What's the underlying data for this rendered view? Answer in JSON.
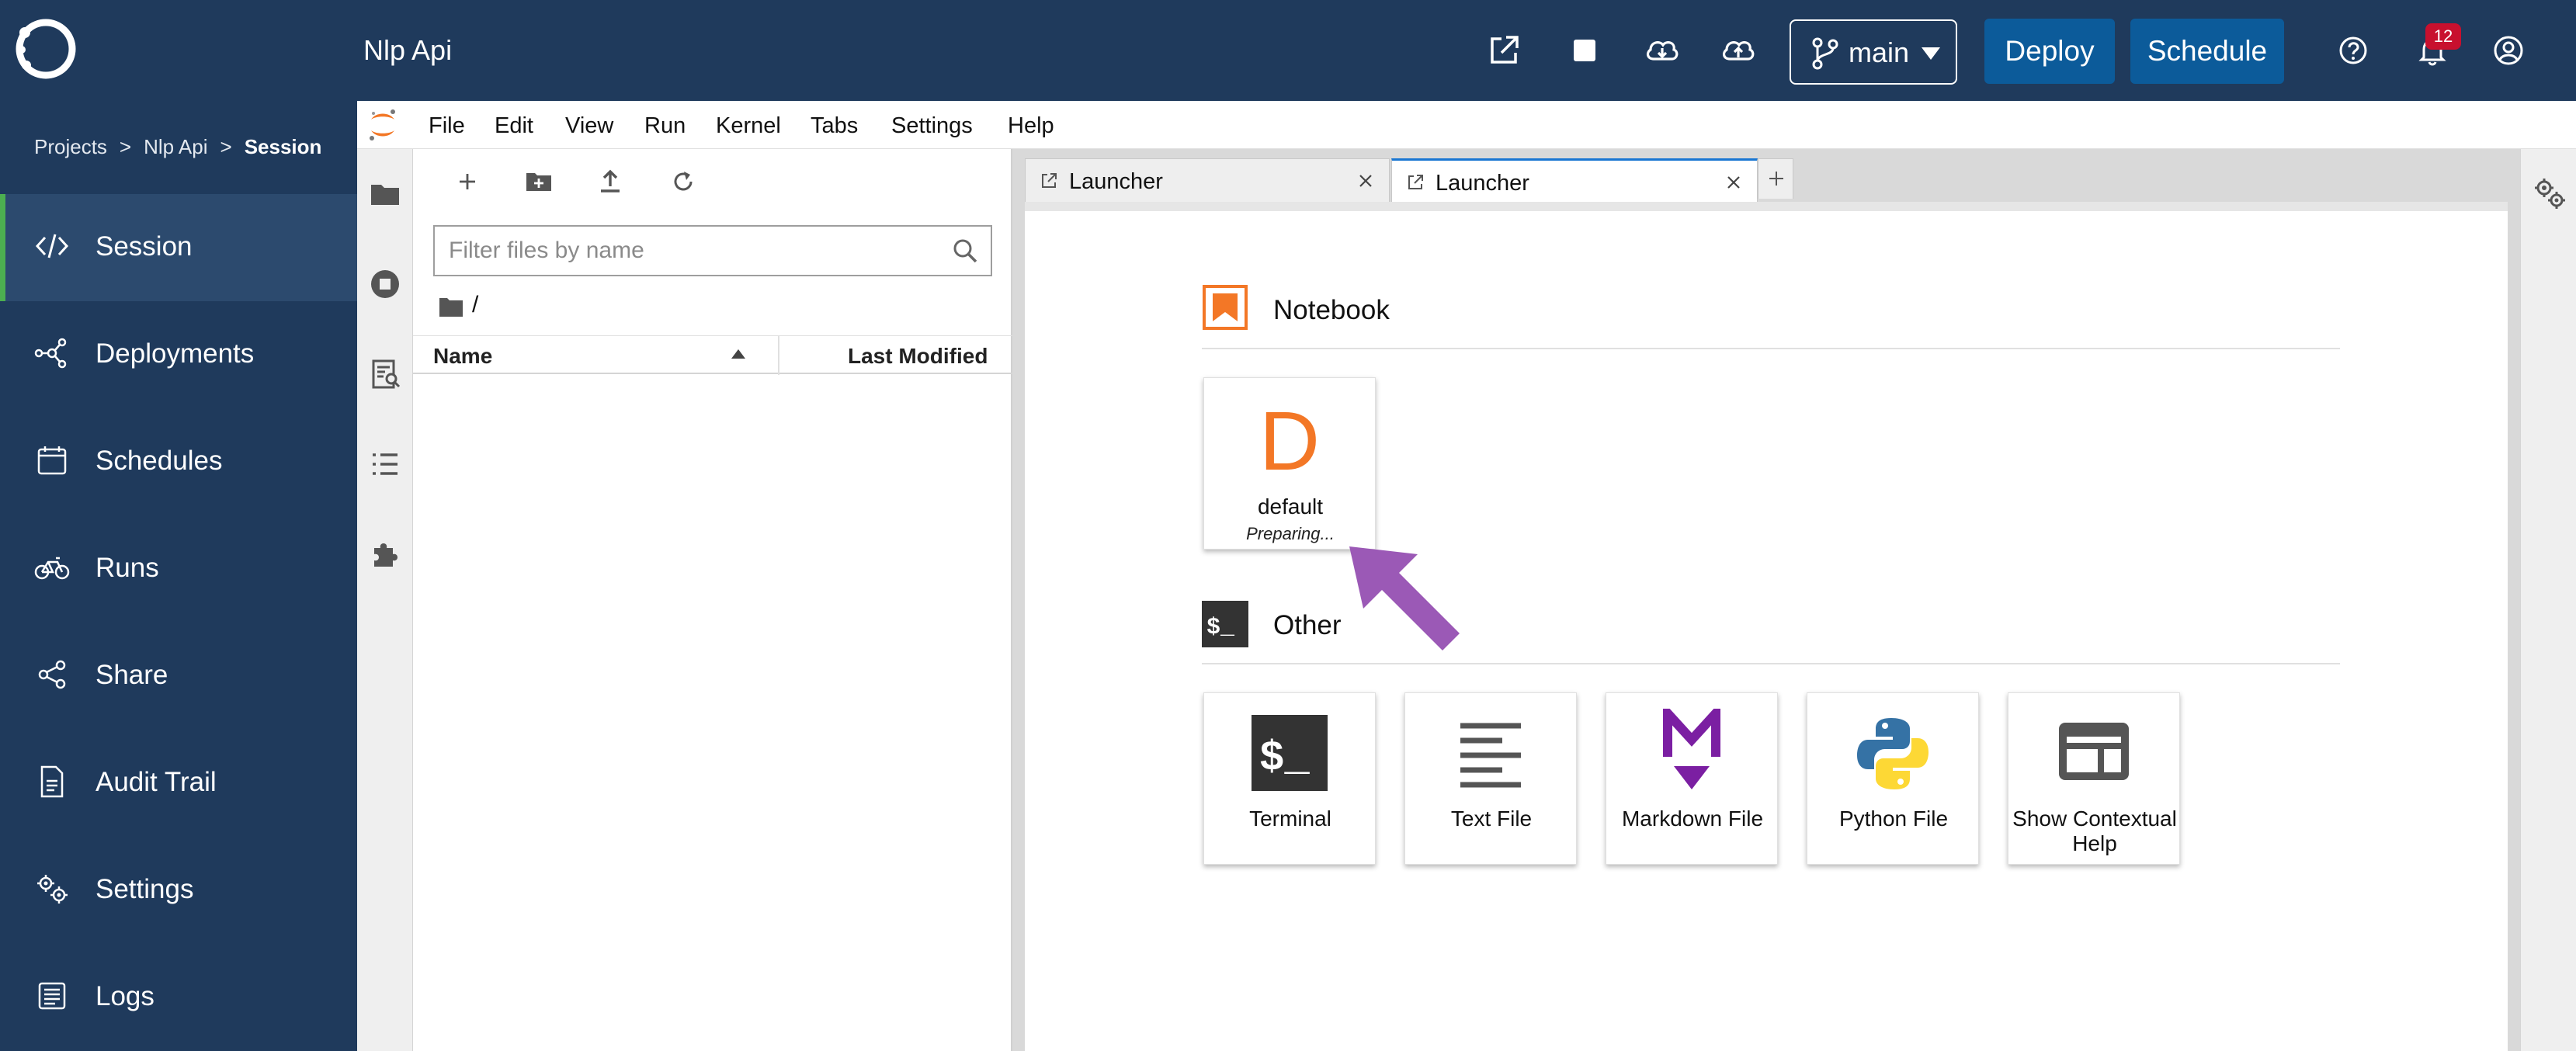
{
  "app": {
    "project_title": "Nlp Api",
    "notification_count": "12",
    "branch": "main",
    "deploy_label": "Deploy",
    "schedule_label": "Schedule"
  },
  "colors": {
    "nav_bg": "#1f3a5c",
    "nav_active_bg": "#2c4a6e",
    "active_indicator": "#4caf50",
    "primary_button": "#0c5b9a",
    "badge": "#c8102e",
    "jupyter_orange": "#f37726",
    "annotation_arrow": "#9b59b6"
  },
  "breadcrumb": {
    "items": [
      "Projects",
      "Nlp Api",
      "Session"
    ],
    "separator": ">"
  },
  "nav": {
    "items": [
      {
        "label": "Session",
        "icon": "code-icon",
        "active": true
      },
      {
        "label": "Deployments",
        "icon": "network-icon",
        "active": false
      },
      {
        "label": "Schedules",
        "icon": "calendar-icon",
        "active": false
      },
      {
        "label": "Runs",
        "icon": "bicycle-icon",
        "active": false
      },
      {
        "label": "Share",
        "icon": "share-icon",
        "active": false
      },
      {
        "label": "Audit Trail",
        "icon": "document-icon",
        "active": false
      },
      {
        "label": "Settings",
        "icon": "gears-icon",
        "active": false
      },
      {
        "label": "Logs",
        "icon": "logs-icon",
        "active": false
      }
    ]
  },
  "menu": {
    "items": [
      "File",
      "Edit",
      "View",
      "Run",
      "Kernel",
      "Tabs",
      "Settings",
      "Help"
    ]
  },
  "filebrowser": {
    "search_placeholder": "Filter files by name",
    "path": "/",
    "col_name": "Name",
    "col_modified": "Last Modified"
  },
  "tabs": [
    {
      "label": "Launcher",
      "active": false
    },
    {
      "label": "Launcher",
      "active": true
    }
  ],
  "launcher": {
    "notebook_section": "Notebook",
    "notebook_card": {
      "icon_letter": "D",
      "label": "default",
      "status": "Preparing..."
    },
    "other_section": "Other",
    "other_cards": [
      {
        "label": "Terminal",
        "icon": "terminal-icon"
      },
      {
        "label": "Text File",
        "icon": "text-file-icon"
      },
      {
        "label": "Markdown File",
        "icon": "markdown-icon"
      },
      {
        "label": "Python File",
        "icon": "python-icon"
      },
      {
        "label": "Show Contextual Help",
        "icon": "contextual-help-icon"
      }
    ]
  }
}
